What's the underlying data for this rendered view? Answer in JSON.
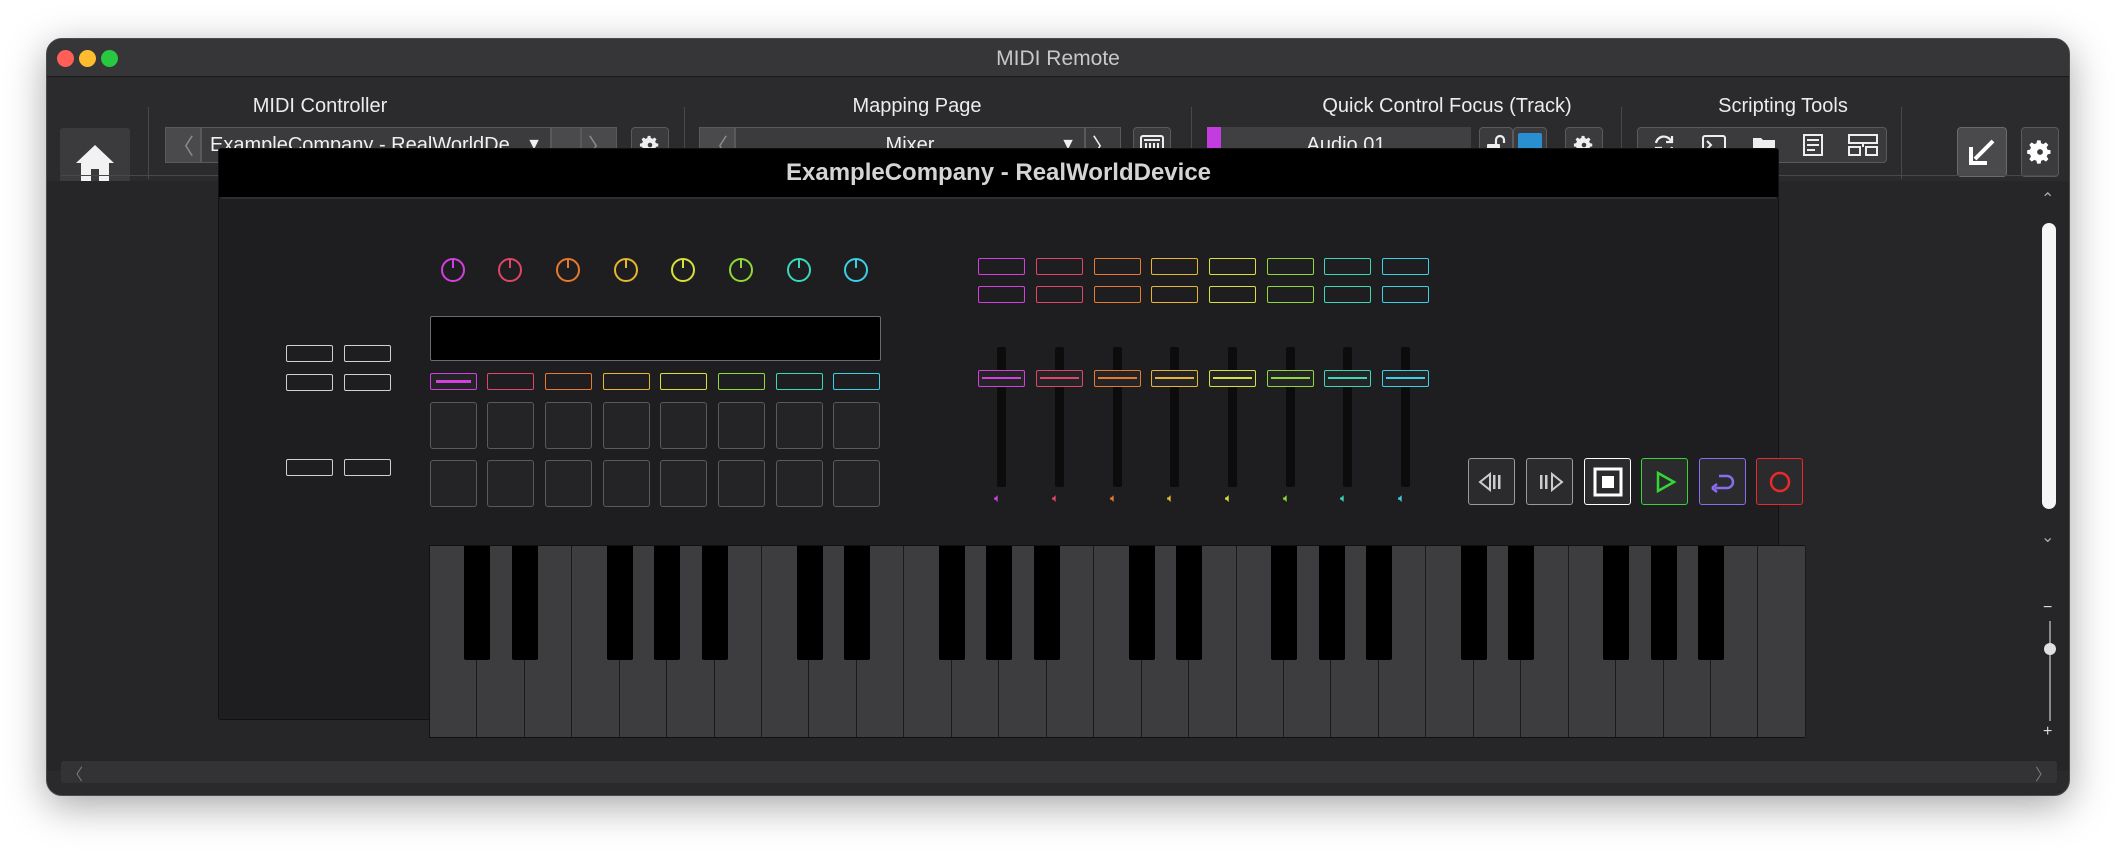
{
  "window": {
    "title": "MIDI Remote"
  },
  "toolbar": {
    "midi_controller": {
      "label": "MIDI Controller",
      "value": "ExampleCompany - RealWorldDe."
    },
    "mapping_page": {
      "label": "Mapping Page",
      "value": "Mixer"
    },
    "quick_control": {
      "label": "Quick Control Focus (Track)",
      "value": "Audio 01",
      "track_color": "#c23ce0",
      "swatch_color": "#2a8fd0"
    },
    "scripting_tools": {
      "label": "Scripting Tools"
    }
  },
  "device": {
    "title": "ExampleCompany - RealWorldDevice",
    "channel_colors": [
      "#d43fe0",
      "#e0456a",
      "#e87a2e",
      "#e8b52e",
      "#d8e03a",
      "#8ed838",
      "#3ad8b8",
      "#3ad0e8"
    ],
    "transport_colors": {
      "play": "#33d633",
      "cycle": "#8a6cf0",
      "record": "#e82a2a"
    }
  },
  "icons": [
    "home-icon",
    "settings-gear-icon",
    "chevron-left-icon",
    "chevron-right-icon",
    "dropdown-caret-icon",
    "mapping-assistant-icon",
    "lock-open-icon",
    "refresh-icon",
    "console-icon",
    "folder-icon",
    "notes-icon",
    "layout-icon",
    "collapse-arrow-icon",
    "speaker-icon",
    "rewind-icon",
    "forward-icon",
    "stop-icon",
    "play-icon",
    "cycle-icon",
    "record-icon"
  ]
}
